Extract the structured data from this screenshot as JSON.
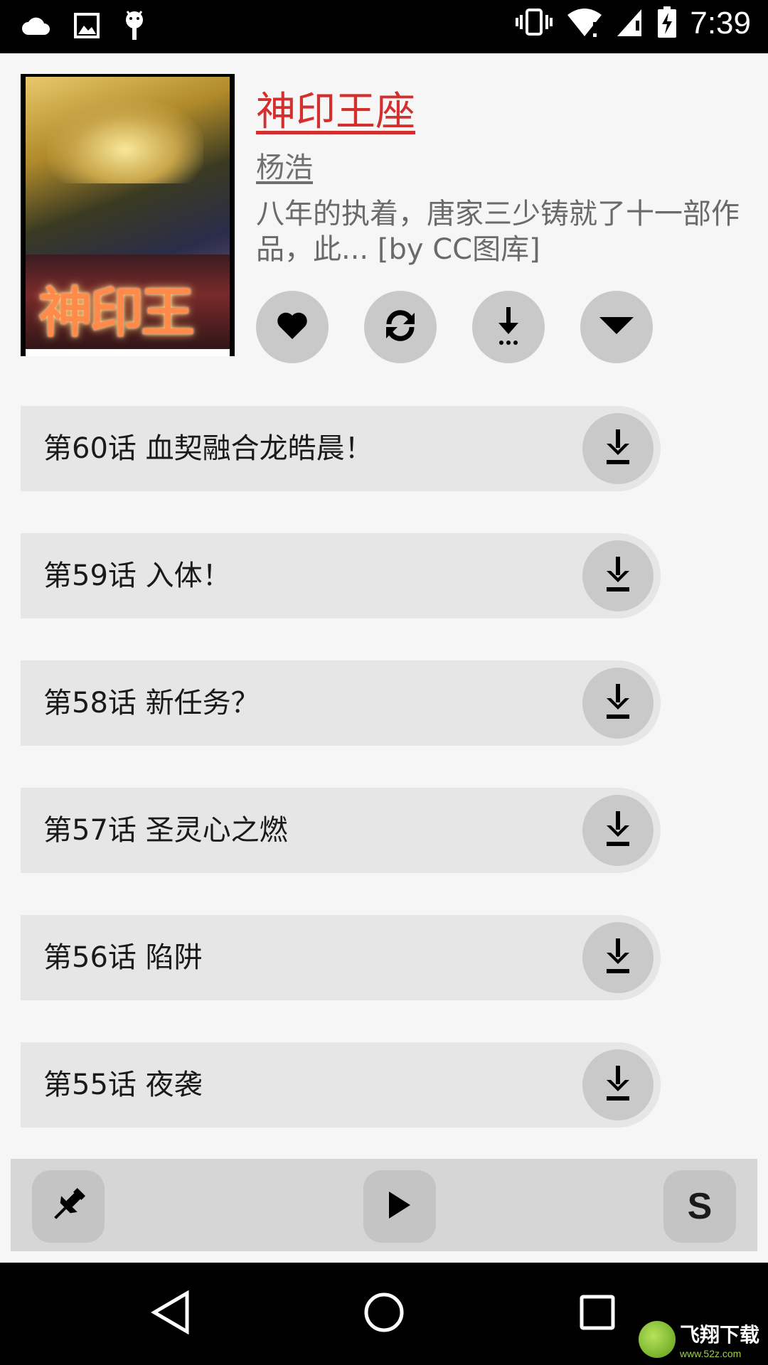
{
  "status_bar": {
    "time": "7:39",
    "left_icons": [
      "cloud-icon",
      "image-icon",
      "android-icon"
    ],
    "right_icons": [
      "vibrate-icon",
      "wifi-icon",
      "signal-icon",
      "battery-charging-icon"
    ]
  },
  "comic": {
    "title": "神印王座",
    "author": "杨浩",
    "description": "八年的执着，唐家三少铸就了十一部作品，此... [by CC图库]"
  },
  "actions": [
    "favorite-icon",
    "refresh-icon",
    "download-all-icon",
    "expand-icon"
  ],
  "chapters": [
    {
      "title": "第60话 血契融合龙皓晨！"
    },
    {
      "title": "第59话 入体！"
    },
    {
      "title": "第58话 新任务？"
    },
    {
      "title": "第57话 圣灵心之燃"
    },
    {
      "title": "第56话 陷阱"
    },
    {
      "title": "第55话 夜袭"
    }
  ],
  "toolbar": {
    "s_label": "S"
  },
  "watermark": {
    "name": "飞翔下载",
    "url": "www.52z.com"
  },
  "colors": {
    "title": "#d32f2f",
    "chip_bg": "#e6e6e6",
    "button_bg": "#c9c9c9"
  }
}
